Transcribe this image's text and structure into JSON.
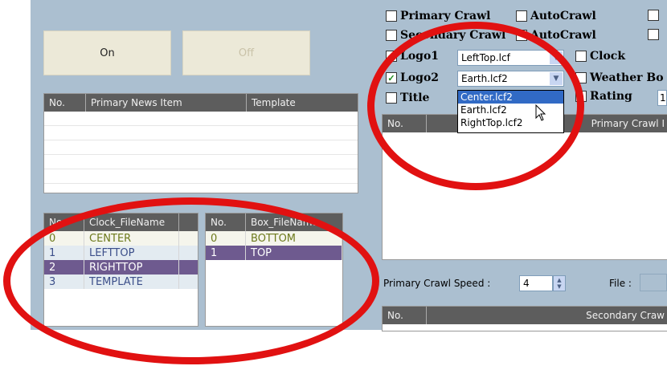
{
  "buttons": {
    "on": "On",
    "off": "Off"
  },
  "news_table": {
    "headers": [
      "No.",
      "Primary News Item",
      "Template"
    ],
    "rows": []
  },
  "clock_table": {
    "headers": [
      "No.",
      "Clock_FileName"
    ],
    "rows": [
      {
        "no": "0",
        "name": "CENTER"
      },
      {
        "no": "1",
        "name": "LEFTTOP"
      },
      {
        "no": "2",
        "name": "RIGHTTOP"
      },
      {
        "no": "3",
        "name": "TEMPLATE"
      }
    ]
  },
  "box_table": {
    "headers": [
      "No.",
      "Box_FileName"
    ],
    "rows": [
      {
        "no": "0",
        "name": "BOTTOM"
      },
      {
        "no": "1",
        "name": "TOP"
      }
    ]
  },
  "options": {
    "primary_crawl": "Primary Crawl",
    "auto_crawl_1": "AutoCrawl",
    "secondary_crawl": "Secondary Crawl",
    "auto_crawl_2": "AutoCrawl",
    "logo1": "Logo1",
    "logo2": "Logo2",
    "title": "Title",
    "clock": "Clock",
    "weather_box": "Weather Bo",
    "rating": "Rating",
    "rating_value": "1"
  },
  "combos": {
    "logo1_value": "LeftTop.lcf",
    "logo2_value": "Earth.lcf2"
  },
  "dropdown": {
    "options": [
      "Center.lcf2",
      "Earth.lcf2",
      "RightTop.lcf2"
    ]
  },
  "crawl_table": {
    "headers": [
      "No.",
      "Primary Crawl I"
    ]
  },
  "speed": {
    "label": "Primary Crawl Speed :",
    "value": "4",
    "file_label": "File :"
  },
  "secondary_table": {
    "headers": [
      "No.",
      "Secondary Craw"
    ]
  },
  "colors": {
    "panel_bg": "#abbfd0",
    "header_bg": "#5d5d5d",
    "selected_row": "#6e5a8f",
    "annotation": "#e11111"
  }
}
